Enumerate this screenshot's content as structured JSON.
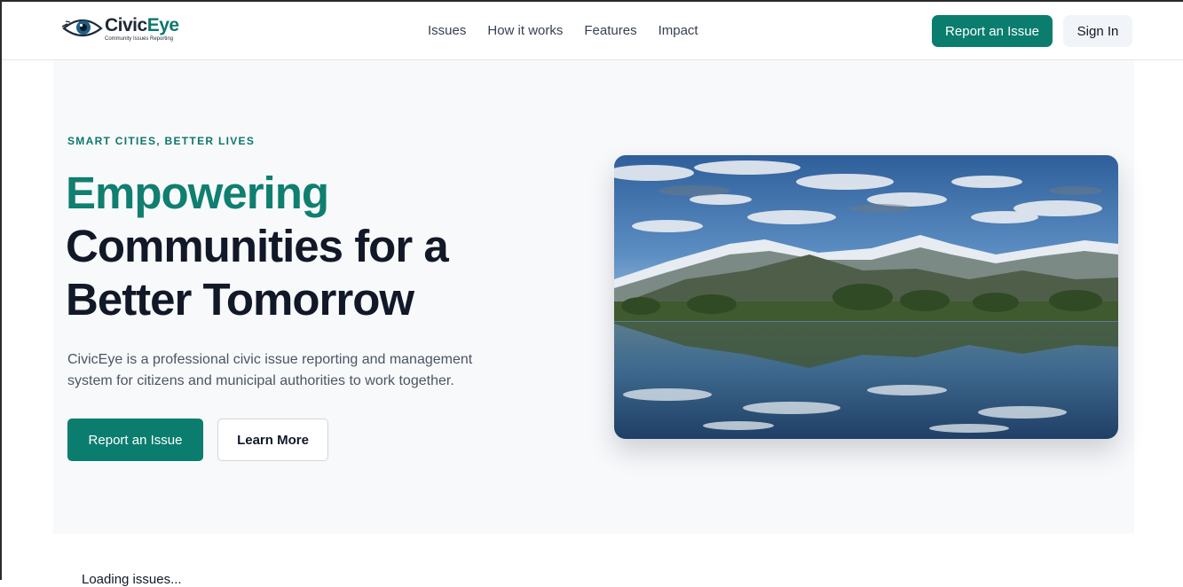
{
  "brand": {
    "name_part1": "Civic",
    "name_part2": "Eye",
    "tagline": "Community Issues Reporting"
  },
  "nav": {
    "items": [
      "Issues",
      "How it works",
      "Features",
      "Impact"
    ]
  },
  "header_actions": {
    "report_label": "Report an Issue",
    "signin_label": "Sign In"
  },
  "hero": {
    "eyebrow": "SMART CITIES, BETTER LIVES",
    "headline_accent": "Empowering",
    "headline_rest": "Communities for a Better Tomorrow",
    "description": "CivicEye is a professional civic issue reporting and management system for citizens and municipal authorities to work together.",
    "primary_button": "Report an Issue",
    "secondary_button": "Learn More"
  },
  "status": {
    "loading_text": "Loading issues..."
  },
  "colors": {
    "brand_teal": "#0b7d6e",
    "heading_dark": "#111827",
    "hero_background": "#f8f9fb"
  }
}
